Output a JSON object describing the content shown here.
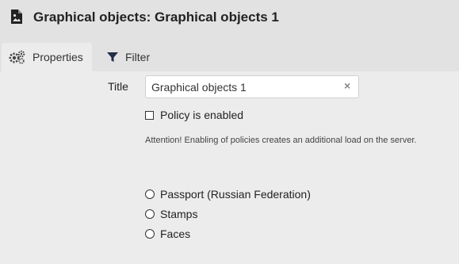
{
  "header": {
    "icon": "image-file-icon",
    "title": "Graphical objects: Graphical objects 1"
  },
  "tabs": [
    {
      "label": "Properties",
      "icon": "gears-icon",
      "active": true
    },
    {
      "label": "Filter",
      "icon": "filter-icon",
      "active": false
    }
  ],
  "form": {
    "title_label": "Title",
    "title_value": "Graphical objects 1",
    "clear_icon": "×",
    "policy_checkbox": {
      "label": "Policy is enabled",
      "checked": false
    },
    "attention_text": "Attention! Enabling of policies creates an additional load on the server.",
    "radio_options": [
      {
        "label": "Passport (Russian Federation)",
        "selected": false
      },
      {
        "label": "Stamps",
        "selected": false
      },
      {
        "label": "Faces",
        "selected": false
      }
    ]
  }
}
